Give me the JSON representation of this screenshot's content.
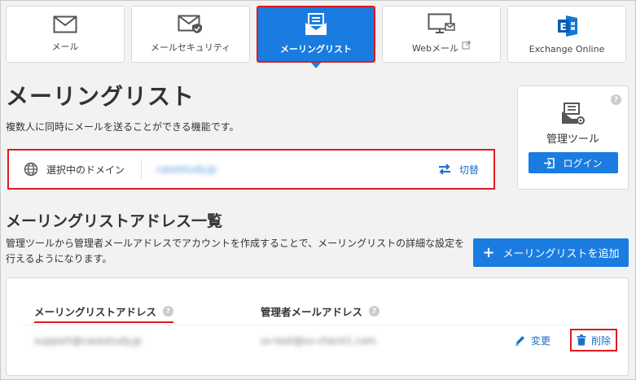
{
  "tabs": [
    {
      "label": "メール",
      "icon": "mail-icon"
    },
    {
      "label": "メールセキュリティ",
      "icon": "mail-security-icon"
    },
    {
      "label": "メーリングリスト",
      "icon": "mailing-list-icon",
      "active": true
    },
    {
      "label": "Webメール",
      "icon": "webmail-icon"
    },
    {
      "label": "Exchange Online",
      "icon": "exchange-icon"
    }
  ],
  "page": {
    "title": "メーリングリスト",
    "description": "複数人に同時にメールを送ることができる機能です。"
  },
  "domain": {
    "label": "選択中のドメイン",
    "value": "casestudy.jp",
    "switch_label": "切替"
  },
  "manager": {
    "title": "管理ツール",
    "login_label": "ログイン",
    "help": "?"
  },
  "section": {
    "title": "メーリングリストアドレス一覧",
    "description": "管理ツールから管理者メールアドレスでアカウントを作成することで、メーリングリストの詳細な設定を行えるようになります。",
    "add_label": "メーリングリストを追加"
  },
  "table": {
    "headers": [
      "メーリングリストアドレス",
      "管理者メールアドレス"
    ],
    "rows": [
      {
        "address": "support@casestudy.jp",
        "admin": "sv-test@sv-check1.com"
      }
    ],
    "edit_label": "変更",
    "delete_label": "削除"
  },
  "colors": {
    "primary": "#1a7ce0",
    "highlight": "#e0191f"
  }
}
